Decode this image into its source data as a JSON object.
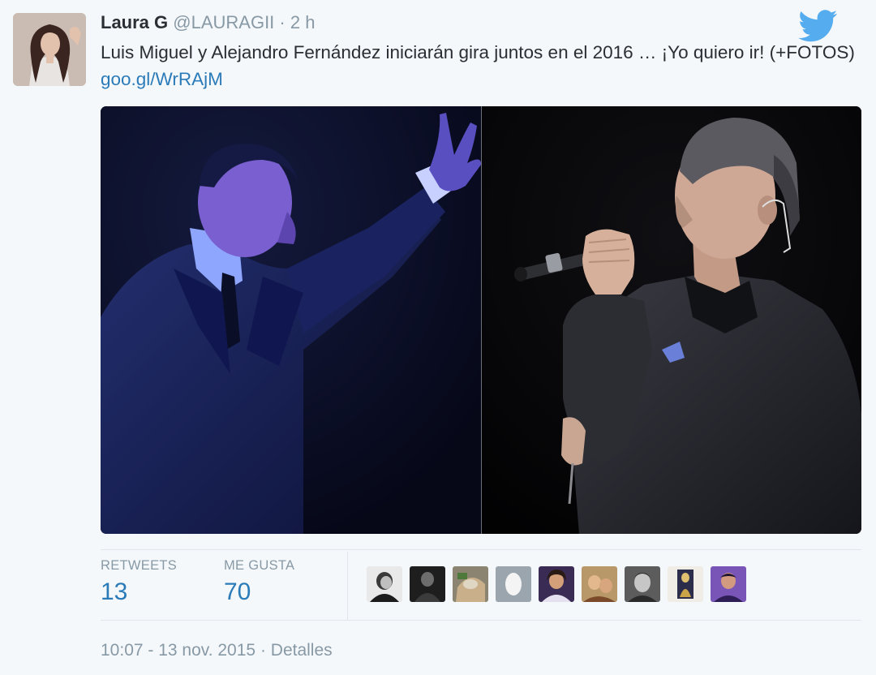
{
  "tweet": {
    "author": {
      "name": "Laura G",
      "handle": "@LAURAGII",
      "avatar_icon": "user-avatar-photo"
    },
    "separator": "·",
    "time": "2 h",
    "text_before_link": "Luis Miguel y Alejandro Fernández iniciarán gira juntos en el 2016 … ¡Yo quiero ir! (+FOTOS) ",
    "link": "goo.gl/WrRAjM",
    "brand_icon": "twitter-bird-icon",
    "colors": {
      "link": "#2b7bb9",
      "brand": "#55acee",
      "muted": "#8899a6",
      "text": "#292f33",
      "background": "#f5f8fa"
    }
  },
  "stats": {
    "retweets_label": "RETWEETS",
    "retweets_count": "13",
    "likes_label": "ME GUSTA",
    "likes_count": "70"
  },
  "likers": [
    {
      "icon": "liker-avatar-1"
    },
    {
      "icon": "liker-avatar-2"
    },
    {
      "icon": "liker-avatar-3"
    },
    {
      "icon": "liker-avatar-4"
    },
    {
      "icon": "liker-avatar-5"
    },
    {
      "icon": "liker-avatar-6"
    },
    {
      "icon": "liker-avatar-7"
    },
    {
      "icon": "liker-avatar-8"
    },
    {
      "icon": "liker-avatar-9"
    }
  ],
  "footer": {
    "timestamp": "10:07 - 13 nov. 2015",
    "separator": "·",
    "details": "Detalles"
  }
}
